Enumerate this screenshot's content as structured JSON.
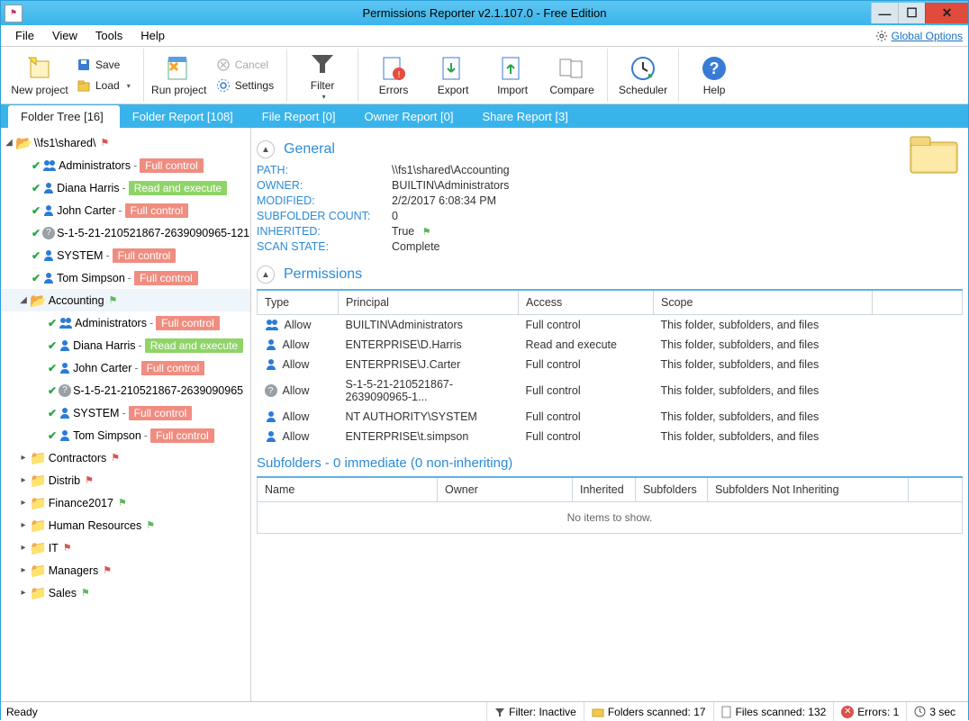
{
  "window": {
    "title": "Permissions Reporter v2.1.107.0 - Free Edition"
  },
  "menus": {
    "file": "File",
    "view": "View",
    "tools": "Tools",
    "help": "Help",
    "global": "Global Options"
  },
  "toolbar": {
    "new_project": "New project",
    "save": "Save",
    "load": "Load",
    "run": "Run project",
    "cancel": "Cancel",
    "settings": "Settings",
    "filter": "Filter",
    "errors": "Errors",
    "export": "Export",
    "import": "Import",
    "compare": "Compare",
    "scheduler": "Scheduler",
    "help": "Help"
  },
  "tabs": {
    "folder_tree": "Folder Tree [16]",
    "folder_report": "Folder Report [108]",
    "file_report": "File Report [0]",
    "owner_report": "Owner Report [0]",
    "share_report": "Share Report [3]"
  },
  "tree": {
    "root": "\\\\fs1\\shared\\",
    "perm_labels": {
      "fc": "Full control",
      "re": "Read and execute"
    },
    "root_entries": [
      {
        "icon": "users",
        "name": "Administrators",
        "perm": "fc"
      },
      {
        "icon": "user",
        "name": "Diana Harris",
        "perm": "re"
      },
      {
        "icon": "user",
        "name": "John Carter",
        "perm": "fc"
      },
      {
        "icon": "q",
        "name": "S-1-5-21-210521867-2639090965-121"
      },
      {
        "icon": "user",
        "name": "SYSTEM",
        "perm": "fc"
      },
      {
        "icon": "user",
        "name": "Tom Simpson",
        "perm": "fc"
      }
    ],
    "accounting": "Accounting",
    "acct_entries": [
      {
        "icon": "users",
        "name": "Administrators",
        "perm": "fc"
      },
      {
        "icon": "user",
        "name": "Diana Harris",
        "perm": "re"
      },
      {
        "icon": "user",
        "name": "John Carter",
        "perm": "fc"
      },
      {
        "icon": "q",
        "name": "S-1-5-21-210521867-2639090965"
      },
      {
        "icon": "user",
        "name": "SYSTEM",
        "perm": "fc"
      },
      {
        "icon": "user",
        "name": "Tom Simpson",
        "perm": "fc"
      }
    ],
    "folders": [
      {
        "name": "Contractors",
        "flag": "red"
      },
      {
        "name": "Distrib",
        "flag": "red"
      },
      {
        "name": "Finance2017",
        "flag": "green"
      },
      {
        "name": "Human Resources",
        "flag": "green"
      },
      {
        "name": "IT",
        "flag": "red"
      },
      {
        "name": "Managers",
        "flag": "red"
      },
      {
        "name": "Sales",
        "flag": "green"
      }
    ]
  },
  "general": {
    "title": "General",
    "labels": {
      "path": "PATH:",
      "owner": "OWNER:",
      "modified": "MODIFIED:",
      "subcount": "SUBFOLDER COUNT:",
      "inherited": "INHERITED:",
      "scanstate": "SCAN STATE:"
    },
    "path": "\\\\fs1\\shared\\Accounting",
    "owner": "BUILTIN\\Administrators",
    "modified": "2/2/2017 6:08:34 PM",
    "subcount": "0",
    "inherited": "True",
    "scanstate": "Complete"
  },
  "perms": {
    "title": "Permissions",
    "headers": {
      "type": "Type",
      "principal": "Principal",
      "access": "Access",
      "scope": "Scope"
    },
    "rows": [
      {
        "icon": "users",
        "type": "Allow",
        "principal": "BUILTIN\\Administrators",
        "access": "Full control",
        "scope": "This folder, subfolders, and files"
      },
      {
        "icon": "user",
        "type": "Allow",
        "principal": "ENTERPRISE\\D.Harris",
        "access": "Read and execute",
        "scope": "This folder, subfolders, and files"
      },
      {
        "icon": "user",
        "type": "Allow",
        "principal": "ENTERPRISE\\J.Carter",
        "access": "Full control",
        "scope": "This folder, subfolders, and files"
      },
      {
        "icon": "q",
        "type": "Allow",
        "principal": "S-1-5-21-210521867-2639090965-1...",
        "access": "Full control",
        "scope": "This folder, subfolders, and files"
      },
      {
        "icon": "user",
        "type": "Allow",
        "principal": "NT AUTHORITY\\SYSTEM",
        "access": "Full control",
        "scope": "This folder, subfolders, and files"
      },
      {
        "icon": "user",
        "type": "Allow",
        "principal": "ENTERPRISE\\t.simpson",
        "access": "Full control",
        "scope": "This folder, subfolders, and files"
      }
    ]
  },
  "subf": {
    "title": "Subfolders - 0 immediate (0 non-inheriting)",
    "headers": {
      "name": "Name",
      "owner": "Owner",
      "inherited": "Inherited",
      "subfolders": "Subfolders",
      "nonin": "Subfolders Not Inheriting"
    },
    "empty": "No items to show."
  },
  "status": {
    "ready": "Ready",
    "filter": "Filter: Inactive",
    "folders": "Folders scanned: 17",
    "files": "Files scanned: 132",
    "errors": "Errors: 1",
    "time": "3 sec"
  }
}
